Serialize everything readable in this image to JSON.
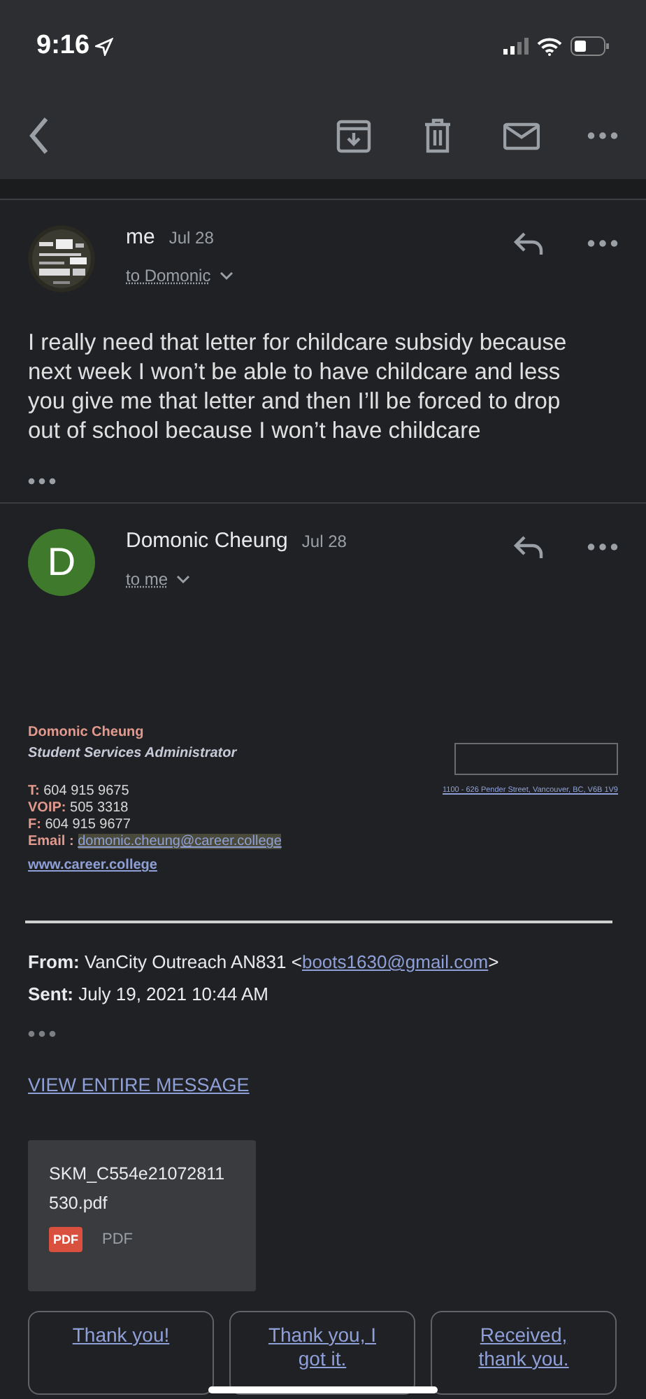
{
  "status_bar": {
    "time": "9:16"
  },
  "messages": [
    {
      "sender": "me",
      "date": "Jul 28",
      "recipient": "to Domonic",
      "body": "I really need that letter for childcare subsidy because next week I won’t be able to have childcare and less you give me that letter and then I’ll be forced to drop out of school because I won’t have childcare"
    },
    {
      "sender": "Domonic Cheung",
      "date": "Jul 28",
      "recipient": "to me",
      "avatar": {
        "kind": "letter",
        "letter": "D",
        "color": "#3f7a2c"
      }
    }
  ],
  "signature": {
    "name": "Domonic Cheung",
    "title": "Student Services Administrator",
    "address": "1100 - 626 Pender Street,  Vancouver, BC, V6B 1V9",
    "lines": [
      {
        "label": "T:",
        "value": "604 915 9675"
      },
      {
        "label": "VOIP:",
        "value": "505 3318"
      },
      {
        "label": "F:",
        "value": "604 915 9677"
      }
    ],
    "email_label": "Email :",
    "email": "domonic.cheung@career.college",
    "website": "www.career.college"
  },
  "forwarded": {
    "from_label": "From:",
    "from_name": "VanCity Outreach AN831 <",
    "from_email": "boots1630@gmail.com",
    "from_end": ">",
    "sent_label": "Sent:",
    "sent": "July 19, 2021 10:44 AM"
  },
  "view_link": "VIEW ENTIRE MESSAGE",
  "attachment": {
    "name": "SKM_C554e21072811 530.pdf",
    "badge": "PDF",
    "type": "PDF"
  },
  "smart_replies": [
    "Thank you!",
    "Thank you, I got it.",
    "Received, thank you."
  ]
}
